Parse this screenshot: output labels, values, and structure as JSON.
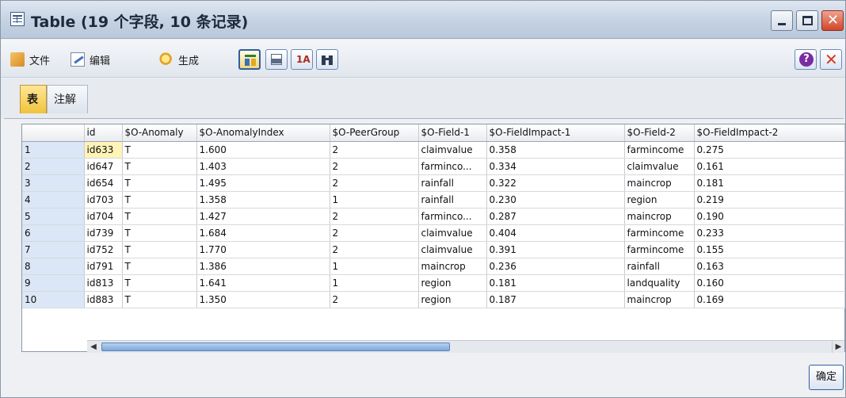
{
  "window": {
    "title": "Table (19 个字段, 10 条记录)"
  },
  "toolbar": {
    "menu": [
      {
        "label": "文件",
        "icon": "file-icon"
      },
      {
        "label": "编辑",
        "icon": "edit-icon"
      },
      {
        "label": "生成",
        "icon": "generate-icon"
      }
    ]
  },
  "tabs": [
    {
      "label": "表",
      "active": true
    },
    {
      "label": "注解",
      "active": false
    }
  ],
  "table": {
    "columns": [
      "",
      "id",
      "$O-Anomaly",
      "$O-AnomalyIndex",
      "$O-PeerGroup",
      "$O-Field-1",
      "$O-FieldImpact-1",
      "$O-Field-2",
      "$O-FieldImpact-2"
    ],
    "rows": [
      [
        "1",
        "id633",
        "T",
        "1.600",
        "2",
        "claimvalue",
        "0.358",
        "farmincome",
        "0.275"
      ],
      [
        "2",
        "id647",
        "T",
        "1.403",
        "2",
        "farminco...",
        "0.334",
        "claimvalue",
        "0.161"
      ],
      [
        "3",
        "id654",
        "T",
        "1.495",
        "2",
        "rainfall",
        "0.322",
        "maincrop",
        "0.181"
      ],
      [
        "4",
        "id703",
        "T",
        "1.358",
        "1",
        "rainfall",
        "0.230",
        "region",
        "0.219"
      ],
      [
        "5",
        "id704",
        "T",
        "1.427",
        "2",
        "farminco...",
        "0.287",
        "maincrop",
        "0.190"
      ],
      [
        "6",
        "id739",
        "T",
        "1.684",
        "2",
        "claimvalue",
        "0.404",
        "farmincome",
        "0.233"
      ],
      [
        "7",
        "id752",
        "T",
        "1.770",
        "2",
        "claimvalue",
        "0.391",
        "farmincome",
        "0.155"
      ],
      [
        "8",
        "id791",
        "T",
        "1.386",
        "1",
        "maincrop",
        "0.236",
        "rainfall",
        "0.163"
      ],
      [
        "9",
        "id813",
        "T",
        "1.641",
        "1",
        "region",
        "0.181",
        "landquality",
        "0.160"
      ],
      [
        "10",
        "id883",
        "T",
        "1.350",
        "2",
        "region",
        "0.187",
        "maincrop",
        "0.169"
      ]
    ]
  },
  "footer": {
    "ok_label": "确定"
  },
  "colors": {
    "accent": "#2f5f9e",
    "active_tab": "#f0c33c",
    "rownum_bg": "#dbe7f6"
  }
}
